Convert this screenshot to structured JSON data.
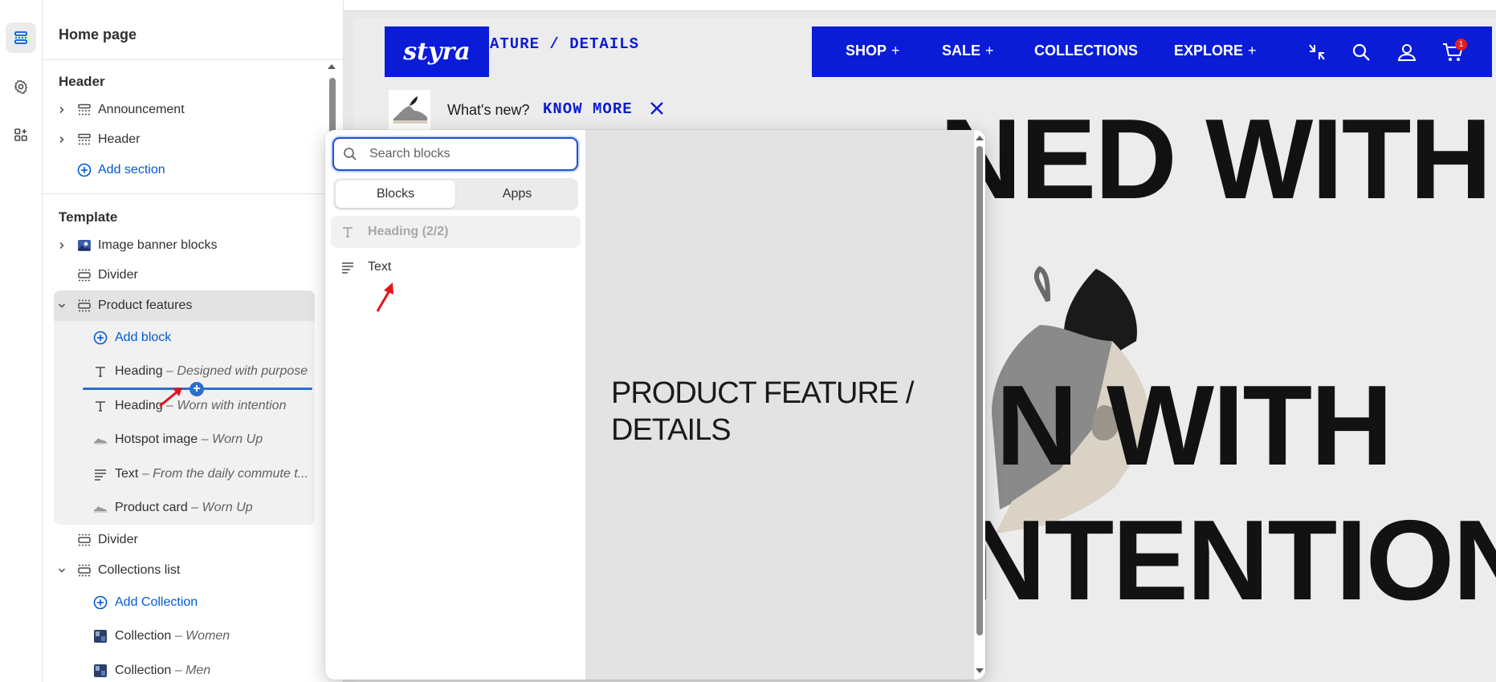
{
  "sidebar": {
    "title": "Home page",
    "header_group": "Header",
    "header_items": [
      {
        "label": "Announcement"
      },
      {
        "label": "Header"
      }
    ],
    "add_section": "Add section",
    "template_group": "Template",
    "template_items": {
      "image_banner": "Image banner blocks",
      "divider1": "Divider",
      "product_features": "Product features",
      "add_block": "Add block",
      "heading1": {
        "type": "Heading",
        "sep": " – ",
        "value": "Designed with purpose"
      },
      "heading2": {
        "type": "Heading",
        "sep": " – ",
        "value": "Worn with intention"
      },
      "hotspot": {
        "type": "Hotspot image",
        "sep": " – ",
        "value": "Worn Up"
      },
      "text": {
        "type": "Text",
        "sep": " – ",
        "value": "From the daily commute t..."
      },
      "product_card": {
        "type": "Product card",
        "sep": " – ",
        "value": "Worn Up"
      },
      "divider2": "Divider",
      "collections_list": "Collections list",
      "add_collection": "Add Collection",
      "collection_women": {
        "type": "Collection",
        "sep": " – ",
        "value": "Women"
      },
      "collection_men": {
        "type": "Collection",
        "sep": " – ",
        "value": "Men"
      }
    }
  },
  "store": {
    "logo": "styra",
    "breadcrumb": "ATURE / DETAILS",
    "nav": {
      "shop": "SHOP",
      "sale": "SALE",
      "collections": "COLLECTIONS",
      "explore": "EXPLORE",
      "plus": "+"
    },
    "cart_count": "1",
    "popup_text": "What's new?",
    "popup_link": "KNOW MORE",
    "hero_line1": "NED WITH",
    "hero_line2": "N WITH",
    "hero_line3": "NTENTION"
  },
  "picker": {
    "search_placeholder": "Search blocks",
    "tabs": {
      "blocks": "Blocks",
      "apps": "Apps"
    },
    "items": [
      {
        "label": "Heading (2/2)",
        "disabled": true
      },
      {
        "label": "Text",
        "disabled": false
      }
    ],
    "preview_title": "PRODUCT FEATURE / DETAILS"
  },
  "colors": {
    "brand_blue": "#0b1cd6",
    "link_blue": "#005bd3",
    "drop_indicator": "#2c6ecb",
    "arrow_red": "#e0141e"
  },
  "icons": {
    "rail": [
      "sections-icon",
      "settings-gear-icon",
      "apps-icon"
    ],
    "nav": [
      "compress-icon",
      "search-icon",
      "account-icon",
      "cart-icon"
    ]
  }
}
